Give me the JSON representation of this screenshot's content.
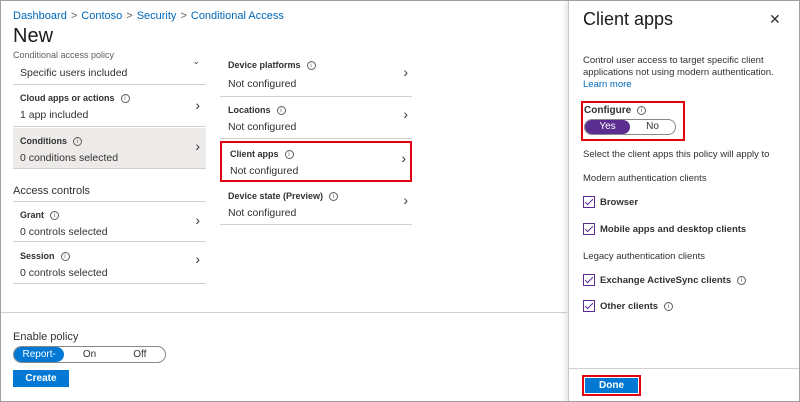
{
  "breadcrumb": [
    "Dashboard",
    "Contoso",
    "Security",
    "Conditional Access"
  ],
  "page": {
    "title": "New",
    "subtitle": "Conditional access policy"
  },
  "assignments": [
    {
      "title": "",
      "value": "Specific users included"
    },
    {
      "title": "Cloud apps or actions",
      "value": "1 app included"
    },
    {
      "title": "Conditions",
      "value": "0 conditions selected"
    }
  ],
  "access_controls": {
    "heading": "Access controls",
    "items": [
      {
        "title": "Grant",
        "value": "0 controls selected"
      },
      {
        "title": "Session",
        "value": "0 controls selected"
      }
    ]
  },
  "conditions": [
    {
      "title": "Device platforms",
      "value": "Not configured"
    },
    {
      "title": "Locations",
      "value": "Not configured"
    },
    {
      "title": "Client apps",
      "value": "Not configured"
    },
    {
      "title": "Device state (Preview)",
      "value": "Not configured"
    }
  ],
  "enable_policy": {
    "label": "Enable policy",
    "options": [
      "Report-only",
      "On",
      "Off"
    ],
    "selected": "Report-only"
  },
  "create_label": "Create",
  "panel": {
    "title": "Client apps",
    "close_symbol": "✕",
    "description": "Control user access to target specific client applications not using modern authentication.",
    "learn_more": "Learn more",
    "configure_label": "Configure",
    "configure_options": [
      "Yes",
      "No"
    ],
    "configure_selected": "Yes",
    "select_text": "Select the client apps this policy will apply to",
    "modern_heading": "Modern authentication clients",
    "modern_items": [
      {
        "label": "Browser",
        "checked": true
      },
      {
        "label": "Mobile apps and desktop clients",
        "checked": true
      }
    ],
    "legacy_heading": "Legacy authentication clients",
    "legacy_items": [
      {
        "label": "Exchange ActiveSync clients",
        "checked": true
      },
      {
        "label": "Other clients",
        "checked": true
      }
    ],
    "done_label": "Done"
  },
  "colors": {
    "accent": "#0078d4",
    "toggle_selected": "#5c2d91",
    "highlight": "#e3000f",
    "link": "#0067b8"
  },
  "icons": {
    "chevron": "chevron-right-icon",
    "info": "info-icon",
    "close": "close-icon"
  }
}
